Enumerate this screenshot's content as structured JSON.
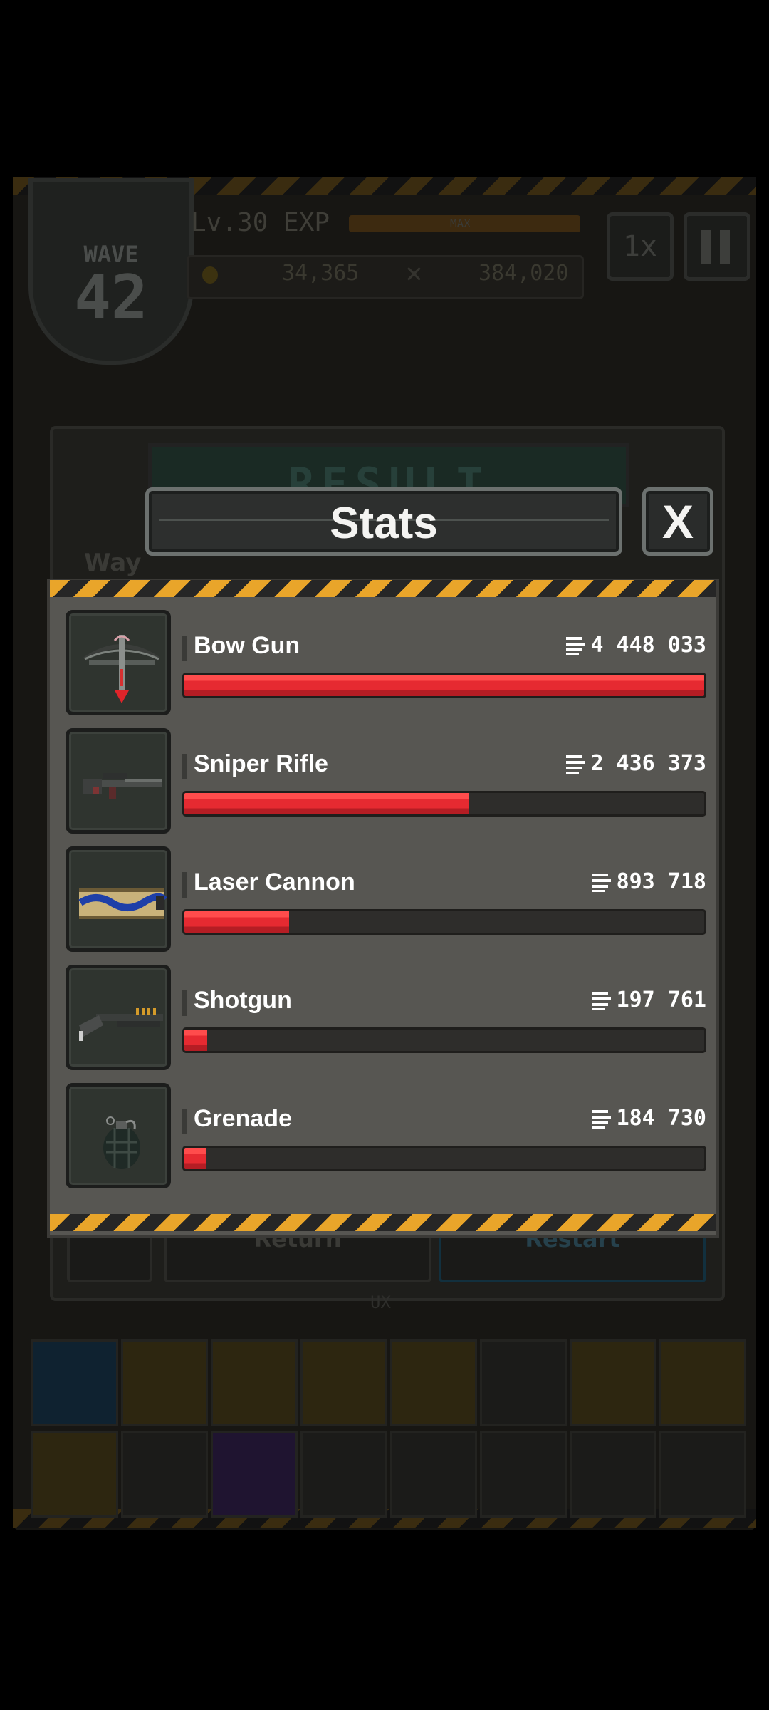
{
  "background": {
    "wave_label": "WAVE",
    "wave_number": "42",
    "level_text": "Lv.30  EXP",
    "exp_max_label": "MAX",
    "coins": "34,365",
    "kills": "384,020",
    "speed_label": "1x",
    "result_title": "RESULT",
    "wave_tab": "Way",
    "return_label": "Return",
    "restart_label": "Restart",
    "ux_label": "UX"
  },
  "dialog": {
    "title": "Stats",
    "close_label": "X"
  },
  "weapons": [
    {
      "name": "Bow Gun",
      "damage": "4 448 033",
      "ratio": 1.0,
      "icon": "bow-gun-icon"
    },
    {
      "name": "Sniper Rifle",
      "damage": "2 436 373",
      "ratio": 0.548,
      "icon": "sniper-rifle-icon"
    },
    {
      "name": "Laser Cannon",
      "damage": "893 718",
      "ratio": 0.201,
      "icon": "laser-cannon-icon"
    },
    {
      "name": "Shotgun",
      "damage": "197 761",
      "ratio": 0.044,
      "icon": "shotgun-icon"
    },
    {
      "name": "Grenade",
      "damage": "184 730",
      "ratio": 0.042,
      "icon": "grenade-icon"
    }
  ],
  "colors": {
    "bar_fill": "#e62a31",
    "hazard_yellow": "#e9a52a",
    "panel": "#575652"
  }
}
